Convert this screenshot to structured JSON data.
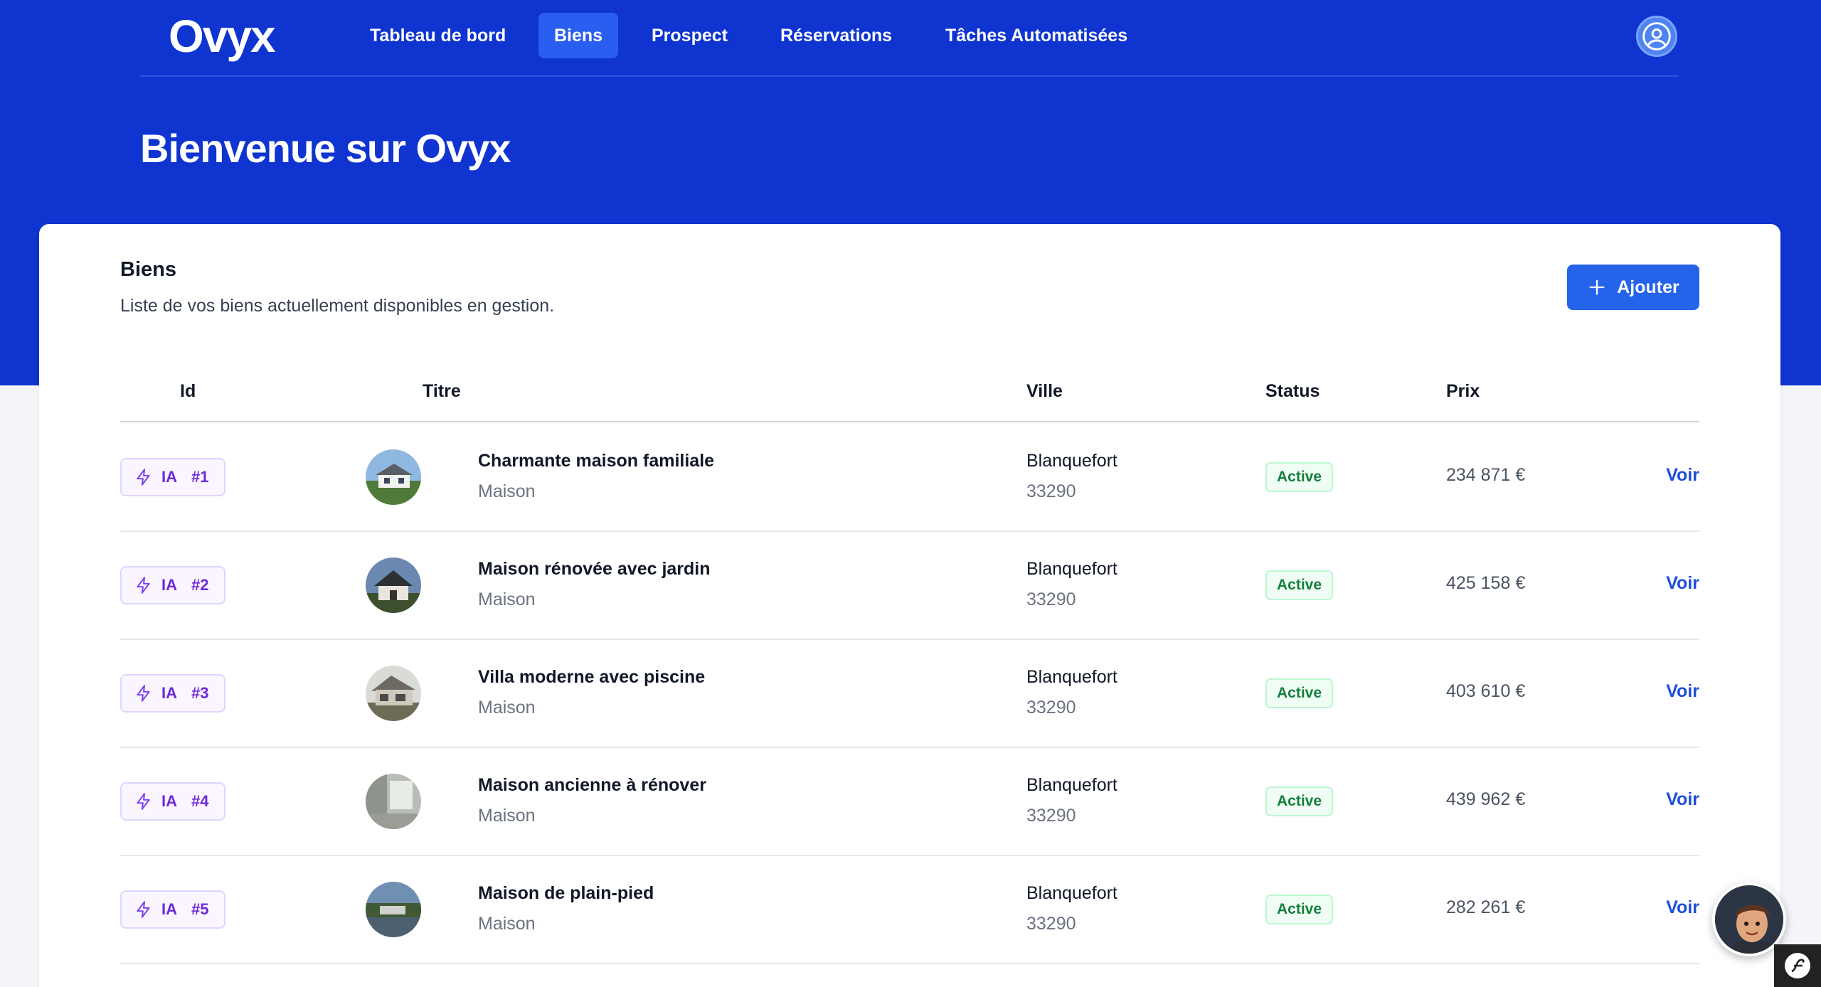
{
  "brand": {
    "logo": "Ovyx"
  },
  "nav": {
    "items": [
      {
        "label": "Tableau de bord",
        "active": false
      },
      {
        "label": "Biens",
        "active": true
      },
      {
        "label": "Prospect",
        "active": false
      },
      {
        "label": "Réservations",
        "active": false
      },
      {
        "label": "Tâches Automatisées",
        "active": false
      }
    ]
  },
  "user_icon": "user-circle-icon",
  "page": {
    "title": "Bienvenue sur Ovyx"
  },
  "section": {
    "title": "Biens",
    "subtitle": "Liste de vos biens actuellement disponibles en gestion.",
    "add_label": "Ajouter"
  },
  "table": {
    "columns": [
      "Id",
      "Titre",
      "Ville",
      "Status",
      "Prix"
    ],
    "rows": [
      {
        "ia": "IA",
        "id": "#1",
        "title": "Charmante maison familiale",
        "type": "Maison",
        "city": "Blanquefort",
        "zip": "33290",
        "status": "Active",
        "price": "234 871 €",
        "action": "Voir"
      },
      {
        "ia": "IA",
        "id": "#2",
        "title": "Maison rénovée avec jardin",
        "type": "Maison",
        "city": "Blanquefort",
        "zip": "33290",
        "status": "Active",
        "price": "425 158 €",
        "action": "Voir"
      },
      {
        "ia": "IA",
        "id": "#3",
        "title": "Villa moderne avec piscine",
        "type": "Maison",
        "city": "Blanquefort",
        "zip": "33290",
        "status": "Active",
        "price": "403 610 €",
        "action": "Voir"
      },
      {
        "ia": "IA",
        "id": "#4",
        "title": "Maison ancienne à rénover",
        "type": "Maison",
        "city": "Blanquefort",
        "zip": "33290",
        "status": "Active",
        "price": "439 962 €",
        "action": "Voir"
      },
      {
        "ia": "IA",
        "id": "#5",
        "title": "Maison de plain-pied",
        "type": "Maison",
        "city": "Blanquefort",
        "zip": "33290",
        "status": "Active",
        "price": "282 261 €",
        "action": "Voir"
      }
    ]
  },
  "colors": {
    "hero": "#0f34d0",
    "accent": "#2563eb",
    "ia_purple": "#6d28d9",
    "status_green": "#15803d"
  }
}
